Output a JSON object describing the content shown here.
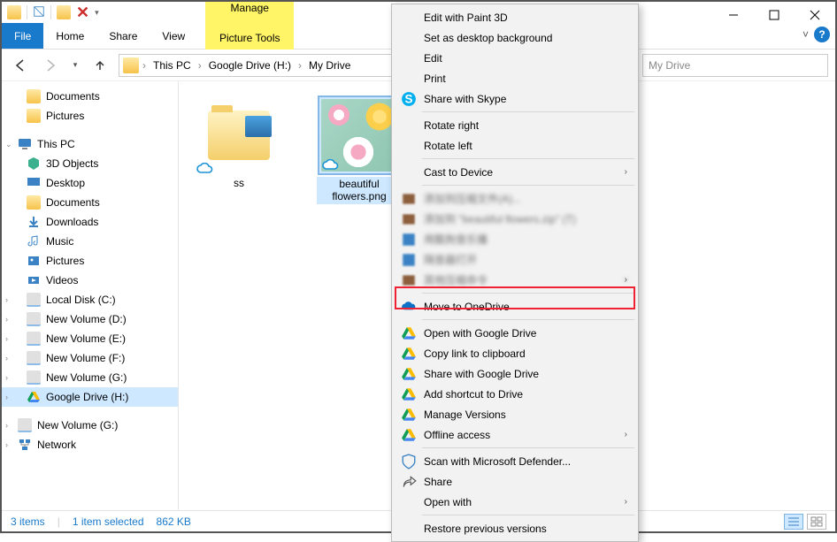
{
  "window": {
    "title": "My Drive"
  },
  "tools_tab": {
    "group": "Manage",
    "tab": "Picture Tools"
  },
  "ribbon": {
    "file": "File",
    "home": "Home",
    "share": "Share",
    "view": "View"
  },
  "breadcrumbs": [
    "This PC",
    "Google Drive (H:)",
    "My Drive"
  ],
  "search_placeholder": "My Drive",
  "sidebar": {
    "quick": [
      {
        "label": "Documents",
        "icon": "folder"
      },
      {
        "label": "Pictures",
        "icon": "folder"
      }
    ],
    "this_pc_label": "This PC",
    "this_pc": [
      {
        "label": "3D Objects",
        "icon": "3d"
      },
      {
        "label": "Desktop",
        "icon": "desktop"
      },
      {
        "label": "Documents",
        "icon": "documents"
      },
      {
        "label": "Downloads",
        "icon": "downloads"
      },
      {
        "label": "Music",
        "icon": "music"
      },
      {
        "label": "Pictures",
        "icon": "pictures"
      },
      {
        "label": "Videos",
        "icon": "videos"
      },
      {
        "label": "Local Disk (C:)",
        "icon": "drive"
      },
      {
        "label": "New Volume (D:)",
        "icon": "drive"
      },
      {
        "label": "New Volume (E:)",
        "icon": "drive"
      },
      {
        "label": "New Volume (F:)",
        "icon": "drive"
      },
      {
        "label": "New Volume (G:)",
        "icon": "drive"
      },
      {
        "label": "Google Drive (H:)",
        "icon": "gdrive",
        "selected": true
      }
    ],
    "after": [
      {
        "label": "New Volume (G:)",
        "icon": "drive"
      },
      {
        "label": "Network",
        "icon": "network"
      }
    ]
  },
  "items": [
    {
      "name": "ss",
      "type": "folder"
    },
    {
      "name": "beautiful flowers.png",
      "type": "image",
      "selected": true
    }
  ],
  "status": {
    "count": "3 items",
    "selection": "1 item selected",
    "size": "862 KB"
  },
  "context_menu": {
    "edit_paint3d": "Edit with Paint 3D",
    "set_bg": "Set as desktop background",
    "edit": "Edit",
    "print": "Print",
    "share_skype": "Share with Skype",
    "rotate_right": "Rotate right",
    "rotate_left": "Rotate left",
    "cast": "Cast to Device",
    "blur1": "添加到压缩文件(A)...",
    "blur2": "添加到 \"beautiful flowers.zip\" (T)",
    "blur3": "用酷狗音乐播",
    "blur4": "隔音器打开",
    "blur5": "其他压缩命令",
    "move_onedrive": "Move to OneDrive",
    "open_gdrive": "Open with Google Drive",
    "copy_link": "Copy link to clipboard",
    "share_gdrive": "Share with Google Drive",
    "add_shortcut": "Add shortcut to Drive",
    "manage_versions": "Manage Versions",
    "offline": "Offline access",
    "defender": "Scan with Microsoft Defender...",
    "share": "Share",
    "open_with": "Open with",
    "restore": "Restore previous versions"
  }
}
